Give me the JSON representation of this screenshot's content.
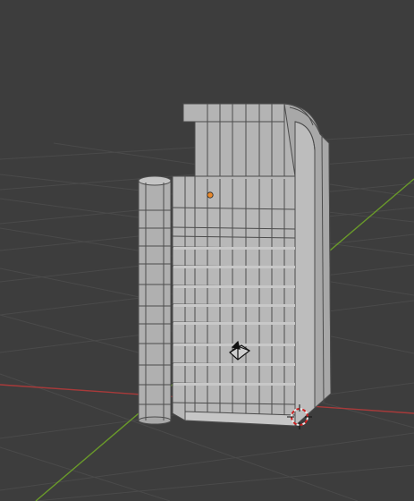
{
  "viewport": {
    "background": "#3d3d3d",
    "grid_color": "#4a4a4a",
    "x_axis_color": "#a83a3a",
    "y_axis_color": "#6a9a2a"
  },
  "model": {
    "body_color": "#b4b4b4",
    "shadow_color": "#969696",
    "edge_color": "#4c4c4c",
    "origin_dot_color": "#e9892c",
    "camera_icon": "camera-object-icon",
    "cursor_icon": "3d-cursor-icon"
  }
}
